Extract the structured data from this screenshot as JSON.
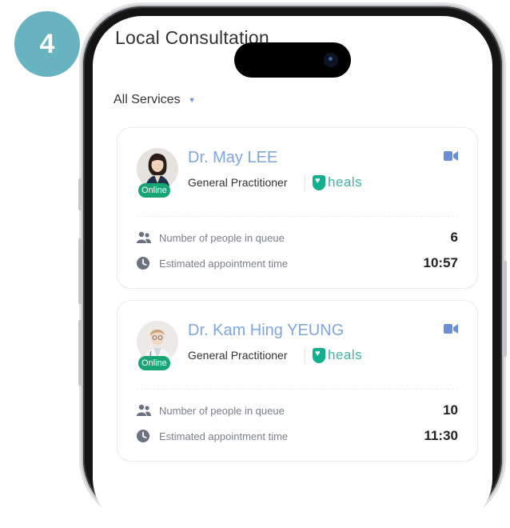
{
  "step_badge": "4",
  "app": {
    "title": "Local Consultation"
  },
  "filter": {
    "label": "All Services",
    "caret": "▼"
  },
  "doctors": [
    {
      "name": "Dr. May LEE",
      "specialty": "General Practitioner",
      "status": "Online",
      "brand": "heals",
      "queue_label": "Number of people in queue",
      "queue_value": "6",
      "time_label": "Estimated appointment time",
      "time_value": "10:57"
    },
    {
      "name": "Dr. Kam Hing YEUNG",
      "specialty": "General Practitioner",
      "status": "Online",
      "brand": "heals",
      "queue_label": "Number of people in queue",
      "queue_value": "10",
      "time_label": "Estimated appointment time",
      "time_value": "11:30"
    }
  ],
  "colors": {
    "badge": "#67b3c0",
    "doctor_name": "#7fa5e3",
    "online": "#17a673",
    "brand": "#37b69e",
    "icon_gray": "#6b7280",
    "video_icon": "#6a8fd8"
  }
}
